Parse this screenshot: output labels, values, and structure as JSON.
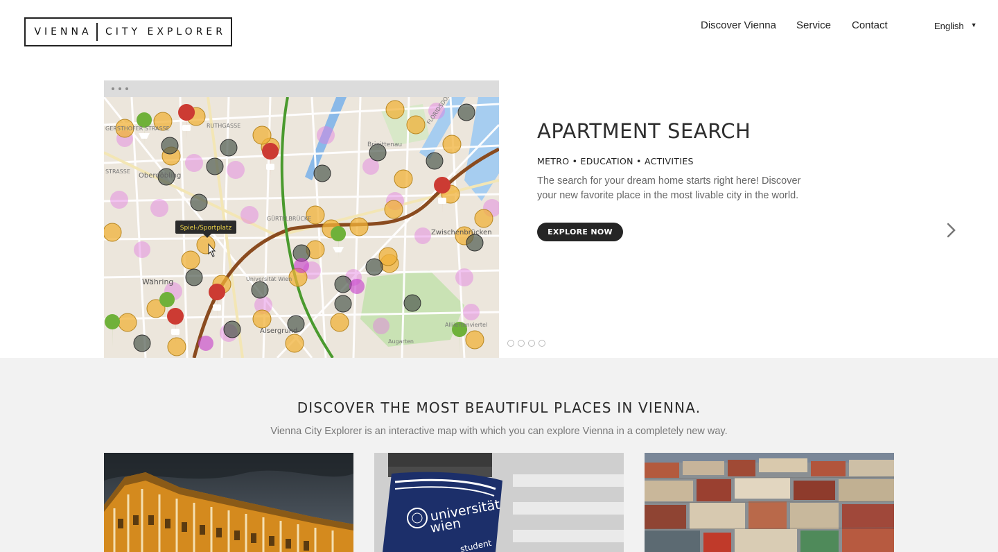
{
  "logo": {
    "part1": "VIENNA",
    "part2": "CITY EXPLORER"
  },
  "nav": {
    "items": [
      {
        "label": "Discover Vienna"
      },
      {
        "label": "Service"
      },
      {
        "label": "Contact"
      }
    ]
  },
  "language": {
    "selected": "English",
    "icon": "caret-down-icon"
  },
  "hero": {
    "title": "APARTMENT SEARCH",
    "subtitle": "METRO • EDUCATION • ACTIVITIES",
    "text": "The search for your dream home starts right here! Discover your new favorite place in the most livable city in the world.",
    "button": "EXPLORE NOW",
    "next_icon": "chevron-right-icon",
    "slides_count": 4,
    "active_slide": 1
  },
  "map": {
    "tooltip": "Spiel-/Sportplatz",
    "labels": {
      "gersthofer": "GERSTHOFER STRASSE",
      "ruthgasse": "RUTHGASSE",
      "oberdobling": "Oberdöbling",
      "strasse": "STRASSE",
      "brigittenau": "Brigittenau",
      "gurtel": "GÜRTELBRÜCKE",
      "wahring": "Währing",
      "universitat": "Universität Wien",
      "alsergrund": "Alsergrund",
      "zwischen": "Zwischenbrücken",
      "augarten": "Augarten",
      "alliierten": "Alliiertenviertel",
      "floridsdorf": "FLORIDSDORF"
    },
    "colors": {
      "water": "#a6cdf0",
      "base": "#ece6dc",
      "metro_u4": "#8a4b1f",
      "metro_u6": "#4a9a2e",
      "park": "#c9e2b4"
    }
  },
  "section": {
    "title": "DISCOVER THE MOST BEAUTIFUL PLACES IN VIENNA.",
    "text": "Vienna City Explorer is an interactive map with which you can explore Vienna in a completely new way.",
    "cards": [
      {
        "name": "Schönbrunn Palace photo"
      },
      {
        "name": "Universität Wien bag photo",
        "bag_text_1": "universität",
        "bag_text_2": "wien",
        "bag_text_3": "student"
      },
      {
        "name": "Vienna rooftops photo"
      }
    ]
  }
}
